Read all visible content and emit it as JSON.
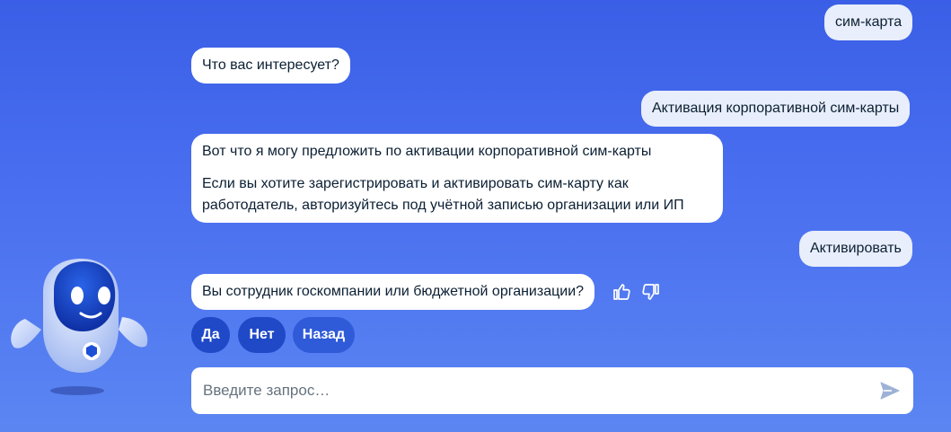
{
  "chat": {
    "messages": [
      {
        "role": "user",
        "text": "сим-карта"
      },
      {
        "role": "bot",
        "text": "Что вас интересует?"
      },
      {
        "role": "user",
        "text": "Активация корпоративной сим-карты"
      },
      {
        "role": "bot",
        "paragraphs": [
          "Вот что я могу предложить по активации корпоративной сим-карты",
          "Если вы хотите зарегистрировать и активировать сим-карту как работодатель, авторизуйтесь под учётной записью организации или ИП"
        ]
      },
      {
        "role": "user",
        "text": "Активировать"
      },
      {
        "role": "bot",
        "text": "Вы сотрудник госкомпании или бюджетной организации?"
      }
    ],
    "quick_replies": [
      "Да",
      "Нет",
      "Назад"
    ],
    "feedback": {
      "like_icon": "thumbs-up-icon",
      "dislike_icon": "thumbs-down-icon"
    }
  },
  "input": {
    "placeholder": "Введите запрос…",
    "value": "",
    "send_icon": "send-icon"
  },
  "assistant": {
    "avatar_icon": "robot-avatar-icon"
  },
  "colors": {
    "background": "#4a6ff0",
    "bot_bubble": "#ffffff",
    "user_bubble": "#e8eefb",
    "button": "#1f49c7"
  }
}
